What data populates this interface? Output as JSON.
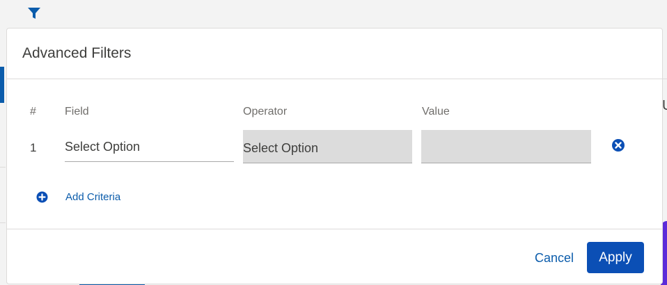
{
  "colors": {
    "brand": "#0b5cab",
    "apply_bg": "#0b4fb5",
    "disabled_field": "#dcdcdc",
    "purple_accent": "#5b2bd9"
  },
  "toolbar": {
    "filter_icon": "filter-funnel-icon"
  },
  "background": {
    "right_edge_letter": "U"
  },
  "modal": {
    "title": "Advanced Filters",
    "columns": {
      "number": "#",
      "field": "Field",
      "operator": "Operator",
      "value": "Value"
    },
    "criteria": [
      {
        "index": "1",
        "field": "Select Option",
        "operator": "Select Option",
        "value": ""
      }
    ],
    "add_criteria_label": "Add Criteria",
    "cancel_label": "Cancel",
    "apply_label": "Apply"
  }
}
